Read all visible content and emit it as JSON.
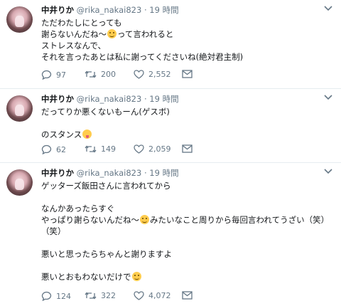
{
  "tweets": [
    {
      "name": "中井りか",
      "handle": "@rika_nakai823",
      "dot": "·",
      "time": "19 時間",
      "lines": [
        "ただわたしにとっても",
        "謝らないんだね〜",
        "って言われると",
        "ストレスなんで、",
        "それを言ったあとは私に謝ってくださいね(絶対君主制)"
      ],
      "replies": "97",
      "retweets": "200",
      "likes": "2,552"
    },
    {
      "name": "中井りか",
      "handle": "@rika_nakai823",
      "dot": "·",
      "time": "19 時間",
      "lines": [
        "だってりか悪くないもーん(ゲスボ)",
        "",
        "のスタンス"
      ],
      "replies": "62",
      "retweets": "149",
      "likes": "2,059"
    },
    {
      "name": "中井りか",
      "handle": "@rika_nakai823",
      "dot": "·",
      "time": "19 時間",
      "lines": [
        "ゲッターズ飯田さんに言われてから",
        "",
        "なんかあったらすぐ",
        "やっぱり謝らないんだね〜",
        "みたいなこと周りから毎回言われてうざい（笑）",
        "（笑）",
        "",
        "悪いと思ったらちゃんと謝りますよ",
        "",
        "悪いとおもわないだけで"
      ],
      "replies": "124",
      "retweets": "322",
      "likes": "4,072"
    }
  ],
  "icons": {
    "reply": "reply-icon",
    "retweet": "retweet-icon",
    "like": "heart-icon",
    "dm": "envelope-icon",
    "more": "chevron-down-icon"
  },
  "colors": {
    "text": "#14171a",
    "muted": "#657786",
    "divider": "#e6ecf0",
    "emoji": "#ffcc4d"
  }
}
